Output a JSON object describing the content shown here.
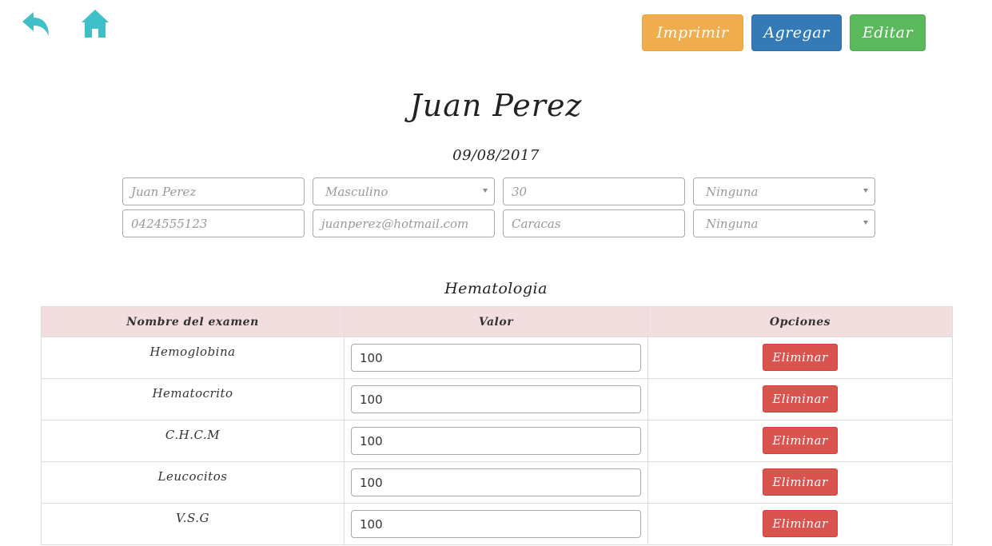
{
  "colors": {
    "icon_teal": "#3fc0c9",
    "print_orange": "#f0ad4e",
    "add_blue": "#337ab7",
    "edit_green": "#5cb85c",
    "delete_red": "#d9534f",
    "table_header_bg": "#f2dede"
  },
  "nav": {
    "back_icon": "reply-arrow-icon",
    "home_icon": "home-icon"
  },
  "toolbar": {
    "print_label": "Imprimir",
    "add_label": "Agregar",
    "edit_label": "Editar"
  },
  "patient": {
    "name": "Juan Perez",
    "date": "09/08/2017"
  },
  "form": {
    "name_placeholder": "Juan Perez",
    "gender_selected": "Masculino",
    "age_placeholder": "30",
    "select1_selected": "Ninguna",
    "phone_placeholder": "0424555123",
    "email_placeholder": "juanperez@hotmail.com",
    "city_placeholder": "Caracas",
    "select2_selected": "Ninguna"
  },
  "section": {
    "title": "Hematologia"
  },
  "table": {
    "headers": [
      "Nombre del examen",
      "Valor",
      "Opciones"
    ],
    "delete_label": "Eliminar",
    "rows": [
      {
        "name": "Hemoglobina",
        "value": "100"
      },
      {
        "name": "Hematocrito",
        "value": "100"
      },
      {
        "name": "C.H.C.M",
        "value": "100"
      },
      {
        "name": "Leucocitos",
        "value": "100"
      },
      {
        "name": "V.S.G",
        "value": "100"
      }
    ]
  }
}
